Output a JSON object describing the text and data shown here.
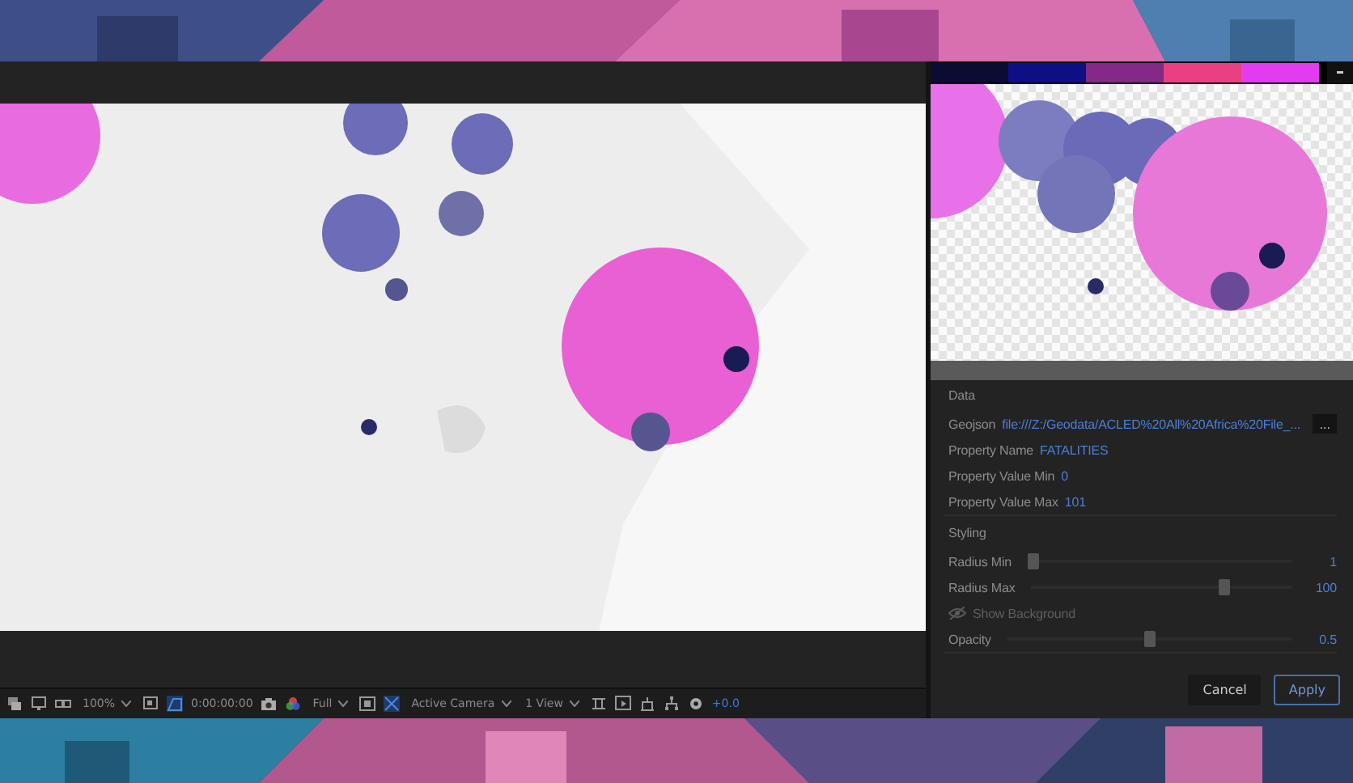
{
  "palette": [
    {
      "color": "#0b0b33"
    },
    {
      "color": "#0f0f85"
    },
    {
      "color": "#842a86"
    },
    {
      "color": "#ea3f80"
    },
    {
      "color": "#e23cf0"
    }
  ],
  "toolbar": {
    "zoom": "100%",
    "timecode": "0:00:00:00",
    "resolution": "Full",
    "camera": "Active Camera",
    "views": "1 View",
    "exposure": "+0.0"
  },
  "data_section": {
    "title": "Data",
    "rows": [
      {
        "label": "Geojson",
        "value": "file:///Z:/Geodata/ACLED%20All%20Africa%20File_...",
        "button": "..."
      },
      {
        "label": "Property Name",
        "value": "FATALITIES"
      },
      {
        "label": "Property Value Min",
        "value": "0"
      },
      {
        "label": "Property Value Max",
        "value": "101"
      }
    ]
  },
  "styling_section": {
    "title": "Styling",
    "rows": [
      {
        "kind": "slider",
        "label": "Radius Min",
        "level": 0.0,
        "reading": "1"
      },
      {
        "kind": "slider",
        "label": "Radius Max",
        "level": 0.75,
        "reading": "100"
      },
      {
        "kind": "toggle",
        "label": "Show Background",
        "disabled": true
      },
      {
        "kind": "slider",
        "label": "Opacity",
        "level": 0.5,
        "reading": "0.5"
      }
    ]
  },
  "buttons": [
    {
      "label": "Cancel",
      "primary": false
    },
    {
      "label": "Apply",
      "primary": true
    }
  ]
}
